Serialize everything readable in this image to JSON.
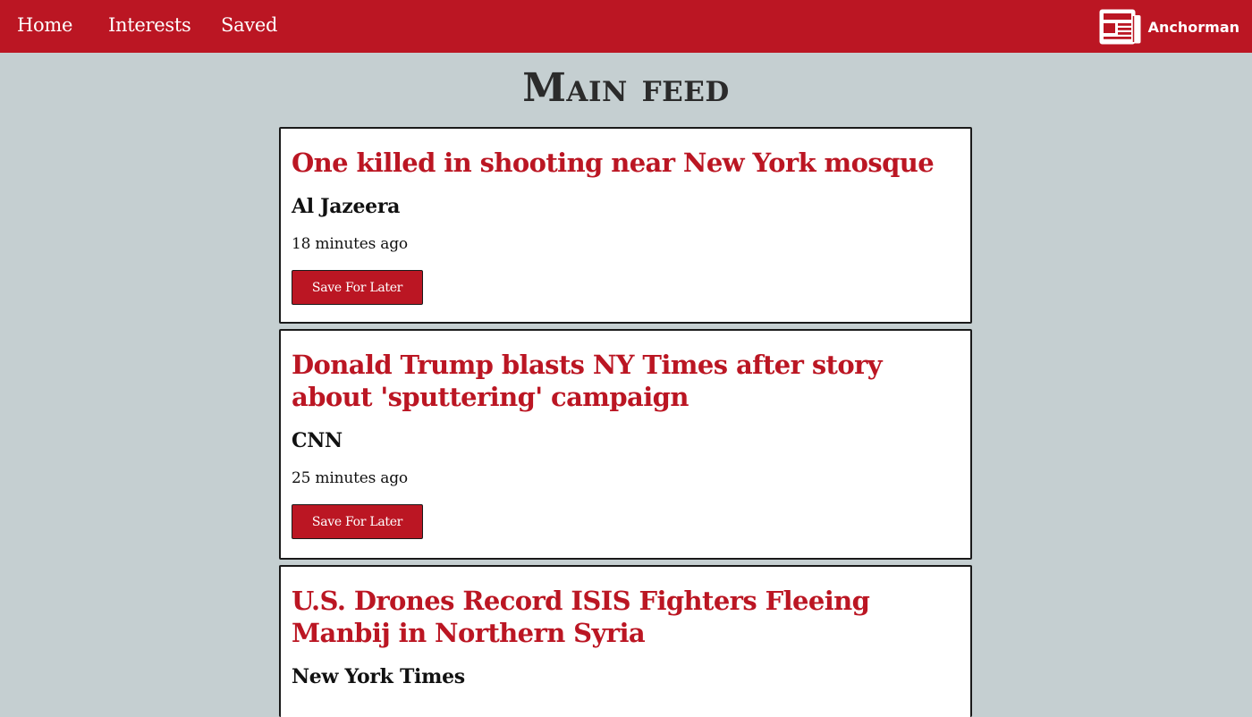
{
  "nav": {
    "links": [
      "Home",
      "Interests",
      "Saved"
    ],
    "brand_name": "Anchorman",
    "brand_icon": "newspaper-icon"
  },
  "page": {
    "title": "Main feed"
  },
  "articles": [
    {
      "title": "One killed in shooting near New York mosque",
      "source": "Al Jazeera",
      "time": "18 minutes ago",
      "button": "Save For Later"
    },
    {
      "title": "Donald Trump blasts NY Times after story about 'sputtering' campaign",
      "source": "CNN",
      "time": "25 minutes ago",
      "button": "Save For Later"
    },
    {
      "title": "U.S. Drones Record ISIS Fighters Fleeing Manbij in Northern Syria",
      "source": "New York Times"
    }
  ],
  "colors": {
    "accent": "#bb1623",
    "background": "#c5cfd1",
    "card": "#ffffff"
  }
}
